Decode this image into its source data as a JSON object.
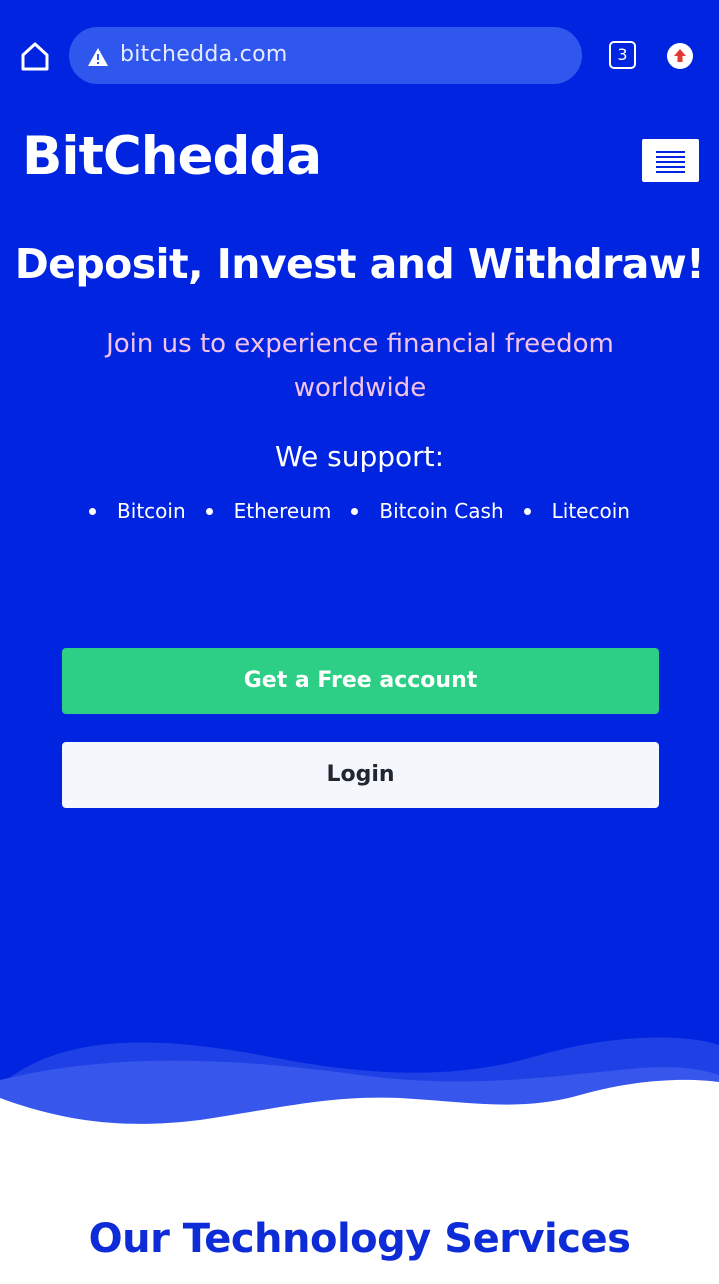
{
  "browser": {
    "url": "bitchedda.com",
    "tab_count": "3",
    "icons": {
      "home": "home-icon",
      "warning": "warning-triangle-icon",
      "tabs": "tabs-counter-icon",
      "update": "update-arrow-icon"
    }
  },
  "header": {
    "brand": "BitChedda",
    "menu_icon": "hamburger-menu-icon"
  },
  "hero": {
    "title": "Deposit, Invest and Withdraw!",
    "subtitle": "Join us to experience financial freedom worldwide",
    "support_label": "We support:",
    "coins": [
      "Bitcoin",
      "Ethereum",
      "Bitcoin Cash",
      "Litecoin"
    ],
    "free_account_label": "Get a Free account",
    "login_label": "Login"
  },
  "services": {
    "title": "Our Technology Services"
  },
  "colors": {
    "background": "#0024e0",
    "accent_green": "#2ccf85",
    "subtitle_pink": "#f3c3e7",
    "section_title": "#0d2bd6"
  }
}
